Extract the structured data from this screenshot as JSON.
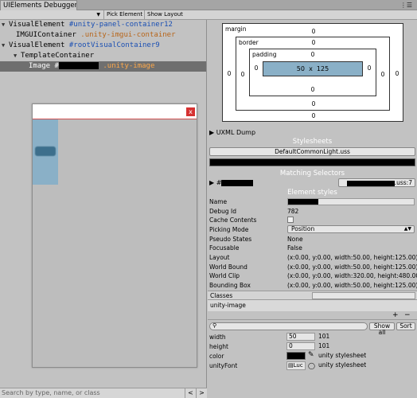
{
  "window": {
    "tab_title": "UIElements Debugger",
    "menu_icon": "menu-icon"
  },
  "toolbar": {
    "panel_selected": "",
    "pick_element": "Pick Element",
    "show_layout": "Show Layout"
  },
  "tree": [
    {
      "type": "VisualElement",
      "name": "#unity-panel-container12",
      "cls": "",
      "depth": 0,
      "expanded": true
    },
    {
      "type": "IMGUIContainer",
      "name": "",
      "cls": ".unity-imgui-container",
      "depth": 1,
      "expanded": false
    },
    {
      "type": "VisualElement",
      "name": "#rootVisualContainer9",
      "cls": "",
      "depth": 0,
      "expanded": true
    },
    {
      "type": "TemplateContainer",
      "name": "",
      "cls": "",
      "depth": 1,
      "expanded": true
    },
    {
      "type": "Image",
      "name": "#",
      "cls": ".unity-image",
      "depth": 2,
      "expanded": false,
      "selected": true
    }
  ],
  "preview": {
    "close_label": "x"
  },
  "search": {
    "placeholder": "Search by type, name, or class",
    "prev": "<",
    "next": ">"
  },
  "box_model": {
    "margin_label": "margin",
    "border_label": "border",
    "padding_label": "padding",
    "margin": {
      "top": "0",
      "right": "0",
      "bottom": "0",
      "left": "0"
    },
    "border": {
      "top": "0",
      "right": "0",
      "bottom": "0",
      "left": "0"
    },
    "padding": {
      "top": "0",
      "right": "0",
      "bottom": "0",
      "left": "0"
    },
    "content": {
      "width": "50",
      "x": "x",
      "height": "125"
    }
  },
  "uxml_dump": "UXML Dump",
  "stylesheets": {
    "title": "Stylesheets",
    "items": [
      "DefaultCommonLight.uss"
    ]
  },
  "matching_selectors": {
    "title": "Matching Selectors",
    "selector": "#",
    "source": ".uss:7"
  },
  "element_styles": {
    "title": "Element styles"
  },
  "properties": [
    {
      "label": "Name",
      "value": ""
    },
    {
      "label": "Debug Id",
      "value": "782"
    },
    {
      "label": "Cache Contents",
      "value": ""
    },
    {
      "label": "Picking Mode",
      "value": "Position"
    },
    {
      "label": "Pseudo States",
      "value": "None"
    },
    {
      "label": "Focusable",
      "value": "False"
    },
    {
      "label": "Layout",
      "value": "(x:0.00, y:0.00, width:50.00, height:125.00)"
    },
    {
      "label": "World Bound",
      "value": "(x:0.00, y:0.00, width:50.00, height:125.00)"
    },
    {
      "label": "World Clip",
      "value": "(x:0.00, y:0.00, width:320.00, height:480.00)"
    },
    {
      "label": "Bounding Box",
      "value": "(x:0.00, y:0.00, width:50.00, height:125.00)"
    }
  ],
  "classes": {
    "title": "Classes",
    "items": [
      "unity-image"
    ],
    "add": "+",
    "remove": "−"
  },
  "style_filter": {
    "show_all": "Show all",
    "sort": "Sort"
  },
  "style_props": [
    {
      "label": "width",
      "value": "50",
      "specificity": "101"
    },
    {
      "label": "height",
      "value": "0",
      "specificity": "101"
    },
    {
      "label": "color",
      "value": "",
      "specificity": "unity stylesheet"
    },
    {
      "label": "unityFont",
      "value": "Luc",
      "specificity": "unity stylesheet"
    }
  ],
  "colors": {
    "selected_row": "#6f6f6f",
    "content_box": "#8ab0c7",
    "close": "#d63232"
  }
}
